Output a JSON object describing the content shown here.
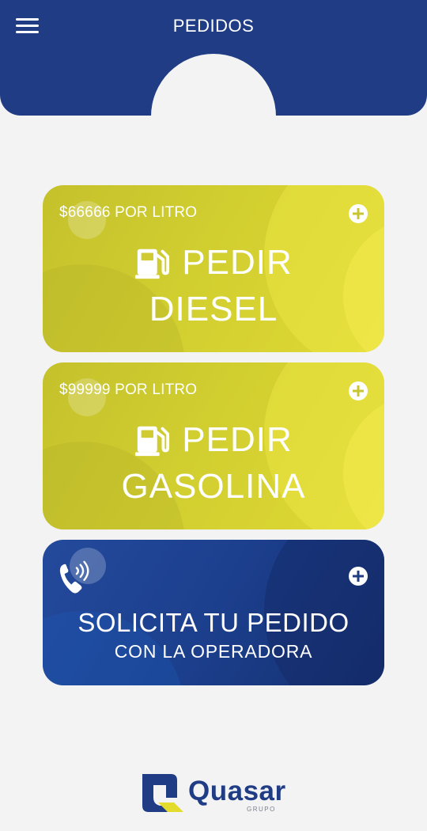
{
  "header": {
    "title": "PEDIDOS",
    "menu_icon": "hamburger-menu-icon",
    "background": "#1f3c84"
  },
  "cards": [
    {
      "price": "$66666 POR LITRO",
      "line1": "PEDIR",
      "line2": "DIESEL",
      "icon": "fuel-pump-icon",
      "color": "#d1ce30"
    },
    {
      "price": "$99999 POR LITRO",
      "line1": "PEDIR",
      "line2": "GASOLINA",
      "icon": "fuel-pump-icon",
      "color": "#d1ce30"
    }
  ],
  "operator_card": {
    "line1": "SOLICITA TU PEDIDO",
    "line2": "CON LA OPERADORA",
    "icon": "phone-icon",
    "color": "#1f3c84"
  },
  "logo": {
    "name": "Quasar",
    "sub": "GRUPO"
  }
}
